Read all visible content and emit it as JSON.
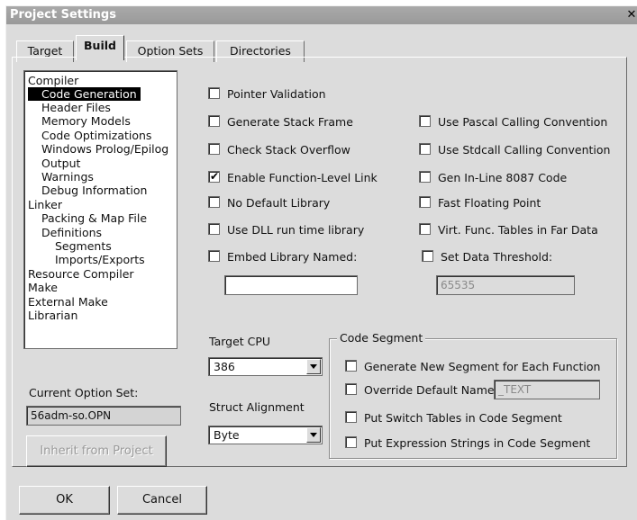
{
  "window": {
    "title": "Project Settings",
    "close_glyph": "✕"
  },
  "tabs": [
    {
      "label": "Target"
    },
    {
      "label": "Build",
      "active": true
    },
    {
      "label": "Option Sets"
    },
    {
      "label": "Directories"
    }
  ],
  "tree": [
    {
      "label": "Compiler"
    },
    {
      "label": "Code Generation",
      "selected": true
    },
    {
      "label": "Header Files"
    },
    {
      "label": "Memory Models"
    },
    {
      "label": "Code Optimizations"
    },
    {
      "label": "Windows Prolog/Epilog"
    },
    {
      "label": "Output"
    },
    {
      "label": "Warnings"
    },
    {
      "label": "Debug Information"
    },
    {
      "label": "Linker"
    },
    {
      "label": "Packing & Map File"
    },
    {
      "label": "Definitions"
    },
    {
      "label": "Segments"
    },
    {
      "label": "Imports/Exports"
    },
    {
      "label": "Resource Compiler"
    },
    {
      "label": "Make"
    },
    {
      "label": "External Make"
    },
    {
      "label": "Librarian"
    }
  ],
  "options_left": [
    {
      "label": "Pointer Validation",
      "checked": false
    },
    {
      "label": "Generate Stack Frame",
      "checked": false
    },
    {
      "label": "Check Stack Overflow",
      "checked": false
    },
    {
      "label": "Enable Function-Level Link",
      "checked": true
    },
    {
      "label": "No Default Library",
      "checked": false
    },
    {
      "label": "Use DLL run time library",
      "checked": false
    },
    {
      "label": "Embed Library Named:",
      "checked": false
    }
  ],
  "embed_library_value": "",
  "options_right": [
    {
      "label": "Use Pascal Calling Convention",
      "checked": false
    },
    {
      "label": "Use Stdcall Calling Convention",
      "checked": false
    },
    {
      "label": "Gen In-Line 8087 Code",
      "checked": false
    },
    {
      "label": "Fast Floating Point",
      "checked": false
    },
    {
      "label": "Virt. Func. Tables in Far Data",
      "checked": false
    },
    {
      "label": "Set Data Threshold:",
      "checked": false
    }
  ],
  "data_threshold_value": "65535",
  "current_option_set": {
    "label": "Current Option Set:",
    "value": "56adm-so.OPN"
  },
  "inherit_button": "Inherit from Project",
  "target_cpu": {
    "label": "Target CPU",
    "value": "386"
  },
  "struct_alignment": {
    "label": "Struct Alignment",
    "value": "Byte"
  },
  "code_segment": {
    "title": "Code Segment",
    "options": [
      {
        "label": "Generate New Segment for Each Function",
        "checked": false
      },
      {
        "label": "Override Default Name",
        "checked": false
      },
      {
        "label": "Put Switch Tables in Code Segment",
        "checked": false
      },
      {
        "label": "Put Expression Strings in Code Segment",
        "checked": false
      }
    ],
    "default_name_value": "_TEXT"
  },
  "buttons": {
    "ok": "OK",
    "cancel": "Cancel"
  }
}
